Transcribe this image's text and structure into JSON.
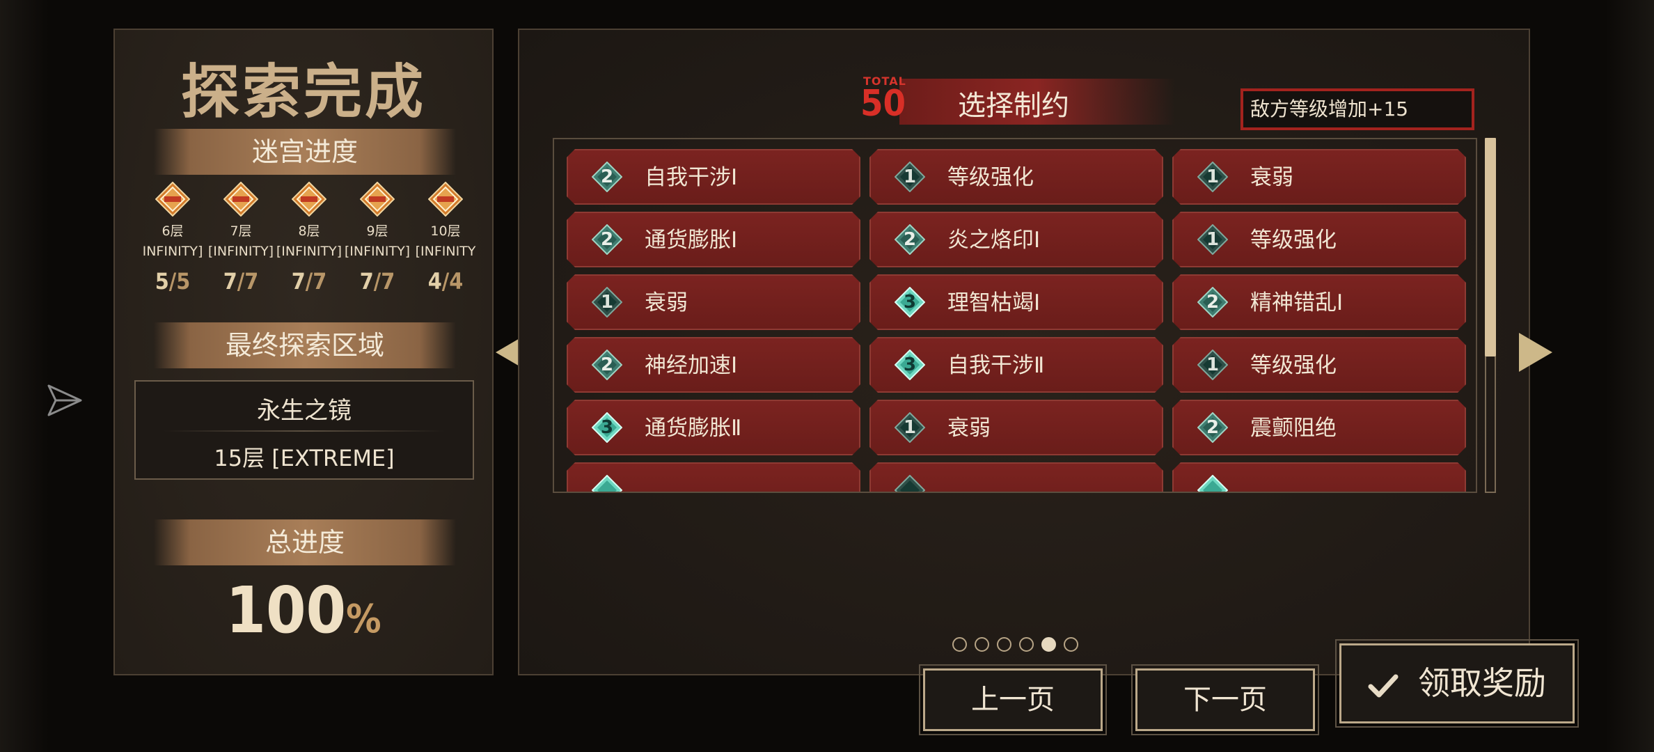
{
  "left_panel": {
    "title": "探索完成",
    "maze_progress_header": "迷宫进度",
    "floors": [
      {
        "name": "6层",
        "mode": "INFINITY]",
        "done": "5",
        "total": "/5"
      },
      {
        "name": "7层",
        "mode": "[INFINITY]",
        "done": "7",
        "total": "/7"
      },
      {
        "name": "8层",
        "mode": "[INFINITY]",
        "done": "7",
        "total": "/7"
      },
      {
        "name": "9层",
        "mode": "[INFINITY]",
        "done": "7",
        "total": "/7"
      },
      {
        "name": "10层",
        "mode": "[INFINITY",
        "done": "4",
        "total": "/4"
      }
    ],
    "final_area_header": "最终探索区域",
    "final_area_name": "永生之镜",
    "final_area_floor": "15层 [EXTREME]",
    "total_progress_header": "总进度",
    "total_progress_value": "100",
    "total_progress_unit": "%"
  },
  "right_panel": {
    "total_label": "TOTAL",
    "total_value": "50",
    "title": "选择制约",
    "effect_text": "敌方等级增加+15",
    "cards": [
      {
        "level": "2",
        "label": "自我干涉Ⅰ",
        "style": "mid"
      },
      {
        "level": "1",
        "label": "等级强化",
        "style": "dark"
      },
      {
        "level": "1",
        "label": "衰弱",
        "style": "dark"
      },
      {
        "level": "2",
        "label": "通货膨胀Ⅰ",
        "style": "mid"
      },
      {
        "level": "2",
        "label": "炎之烙印Ⅰ",
        "style": "mid"
      },
      {
        "level": "1",
        "label": "等级强化",
        "style": "dark"
      },
      {
        "level": "1",
        "label": "衰弱",
        "style": "dark"
      },
      {
        "level": "3",
        "label": "理智枯竭Ⅰ",
        "style": "bright"
      },
      {
        "level": "2",
        "label": "精神错乱Ⅰ",
        "style": "mid"
      },
      {
        "level": "2",
        "label": "神经加速Ⅰ",
        "style": "mid"
      },
      {
        "level": "3",
        "label": "自我干涉Ⅱ",
        "style": "bright"
      },
      {
        "level": "1",
        "label": "等级强化",
        "style": "dark"
      },
      {
        "level": "3",
        "label": "通货膨胀Ⅱ",
        "style": "bright"
      },
      {
        "level": "1",
        "label": "衰弱",
        "style": "dark"
      },
      {
        "level": "2",
        "label": "震颤阻绝",
        "style": "mid"
      },
      {
        "level": "",
        "label": "",
        "style": "bright"
      },
      {
        "level": "",
        "label": "",
        "style": "dark"
      },
      {
        "level": "",
        "label": "",
        "style": "bright"
      }
    ],
    "page_count": 6,
    "active_page": 5
  },
  "buttons": {
    "prev": "上一页",
    "next": "下一页",
    "claim": "领取奖励"
  },
  "colors": {
    "accent_red": "#d82f27",
    "card_red": "#7b2320",
    "gold": "#cbb08a"
  }
}
